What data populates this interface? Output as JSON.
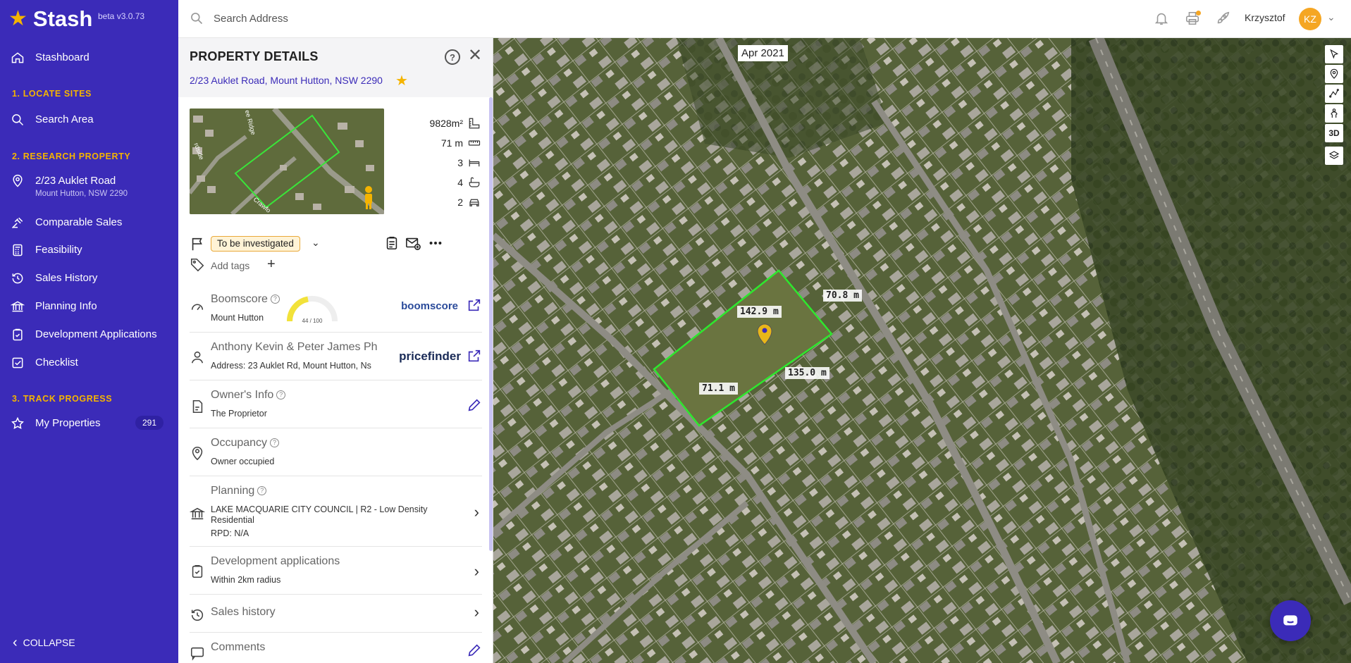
{
  "app": {
    "name": "Stash",
    "version": "beta v3.0.73",
    "brand_color": "#3b2bb8",
    "accent_color": "#f5b400"
  },
  "sidebar": {
    "stashboard": "Stashboard",
    "section1": "1. LOCATE SITES",
    "search_area": "Search Area",
    "section2": "2. RESEARCH PROPERTY",
    "property_title": "2/23 Auklet Road",
    "property_sub": "Mount Hutton, NSW 2290",
    "comparable_sales": "Comparable Sales",
    "feasibility": "Feasibility",
    "sales_history": "Sales History",
    "planning_info": "Planning Info",
    "development_applications": "Development Applications",
    "checklist": "Checklist",
    "section3": "3. TRACK PROGRESS",
    "my_properties": "My Properties",
    "my_properties_count": "291",
    "collapse": "COLLAPSE"
  },
  "topbar": {
    "search_placeholder": "Search Address",
    "username": "Krzysztof",
    "avatar_initials": "KZ"
  },
  "panel": {
    "title": "PROPERTY DETAILS",
    "address": "2/23 Auklet Road, Mount Hutton, NSW 2290",
    "thumb_street_1": "rdside",
    "thumb_street_2": "ee Ridge",
    "thumb_street_3": "Crawfo",
    "stats": {
      "land_area": "9828m²",
      "frontage": "71 m",
      "bedrooms": "3",
      "bathrooms": "4",
      "parking": "2"
    },
    "status": "To be investigated",
    "add_tags": "Add tags",
    "boomscore": {
      "title": "Boomscore",
      "sub": "Mount Hutton",
      "score_text": "44 / 100",
      "score": 44,
      "brand": "boomscore"
    },
    "owner_names": {
      "title": "Anthony Kevin & Peter James Ph",
      "sub": "Address: 23 Auklet Rd, Mount Hutton, Ns",
      "brand": "pricefinder"
    },
    "owners_info": {
      "title": "Owner's Info",
      "sub": "The Proprietor"
    },
    "occupancy": {
      "title": "Occupancy",
      "sub": "Owner occupied"
    },
    "planning": {
      "title": "Planning",
      "sub1": "LAKE MACQUARIE CITY COUNCIL | R2 - Low Density",
      "sub2": "Residential",
      "sub3": "RPD: N/A"
    },
    "dev_apps": {
      "title": "Development applications",
      "sub": "Within 2km radius"
    },
    "sales_history": {
      "title": "Sales history"
    },
    "comments": {
      "title": "Comments"
    }
  },
  "map": {
    "imagery_date": "Apr 2021",
    "dimensions": [
      "142.9 m",
      "70.8 m",
      "135.0 m",
      "71.1 m"
    ],
    "tool_3d": "3D"
  }
}
